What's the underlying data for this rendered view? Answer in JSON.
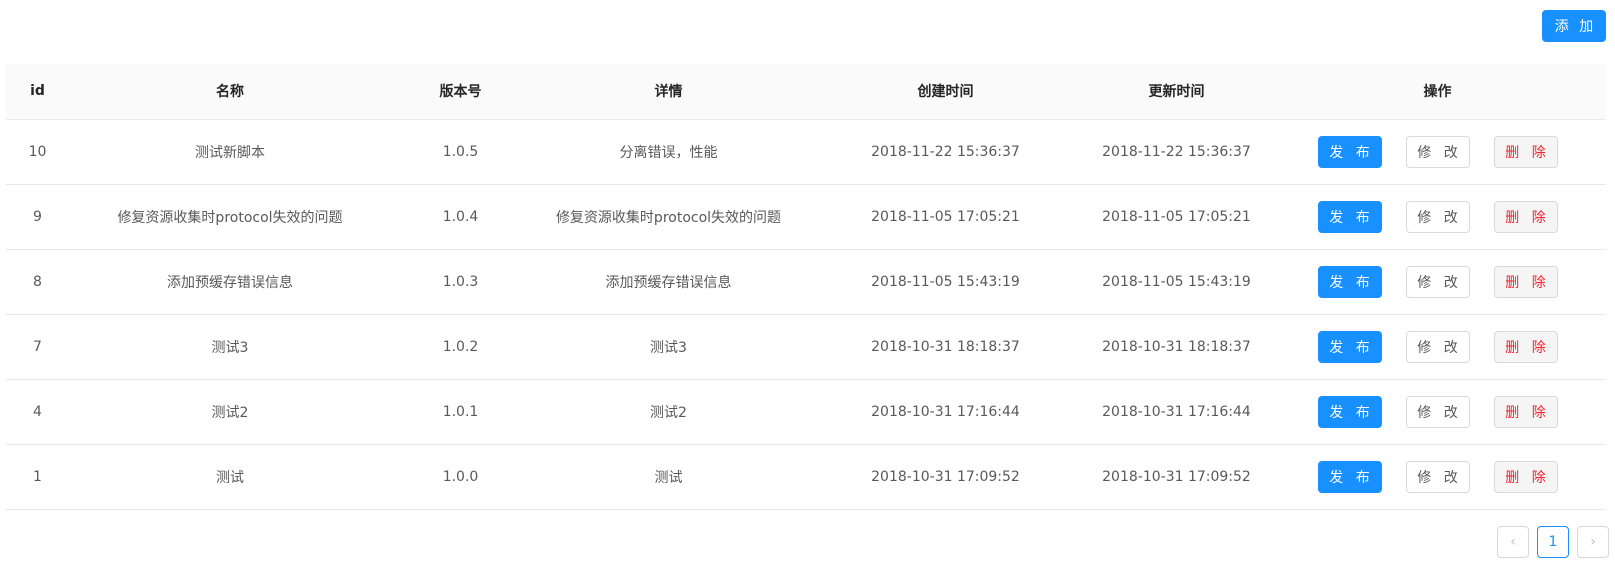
{
  "toolbar": {
    "add_label": "添 加"
  },
  "table": {
    "headers": [
      "id",
      "名称",
      "版本号",
      "详情",
      "创建时间",
      "更新时间",
      "操作"
    ],
    "rows": [
      {
        "id": "10",
        "name": "测试新脚本",
        "version": "1.0.5",
        "detail": "分离错误，性能",
        "created": "2018-11-22 15:36:37",
        "updated": "2018-11-22 15:36:37"
      },
      {
        "id": "9",
        "name": "修复资源收集时protocol失效的问题",
        "version": "1.0.4",
        "detail": "修复资源收集时protocol失效的问题",
        "created": "2018-11-05 17:05:21",
        "updated": "2018-11-05 17:05:21"
      },
      {
        "id": "8",
        "name": "添加预缓存错误信息",
        "version": "1.0.3",
        "detail": "添加预缓存错误信息",
        "created": "2018-11-05 15:43:19",
        "updated": "2018-11-05 15:43:19"
      },
      {
        "id": "7",
        "name": "测试3",
        "version": "1.0.2",
        "detail": "测试3",
        "created": "2018-10-31 18:18:37",
        "updated": "2018-10-31 18:18:37"
      },
      {
        "id": "4",
        "name": "测试2",
        "version": "1.0.1",
        "detail": "测试2",
        "created": "2018-10-31 17:16:44",
        "updated": "2018-10-31 17:16:44"
      },
      {
        "id": "1",
        "name": "测试",
        "version": "1.0.0",
        "detail": "测试",
        "created": "2018-10-31 17:09:52",
        "updated": "2018-10-31 17:09:52"
      }
    ],
    "actions": {
      "publish": "发 布",
      "edit": "修 改",
      "delete": "删 除"
    }
  },
  "pagination": {
    "prev": "‹",
    "current": "1",
    "next": "›"
  },
  "colors": {
    "primary": "#1890ff",
    "danger": "#f5222d",
    "header_bg": "#fafafa",
    "border": "#e8e8e8"
  }
}
